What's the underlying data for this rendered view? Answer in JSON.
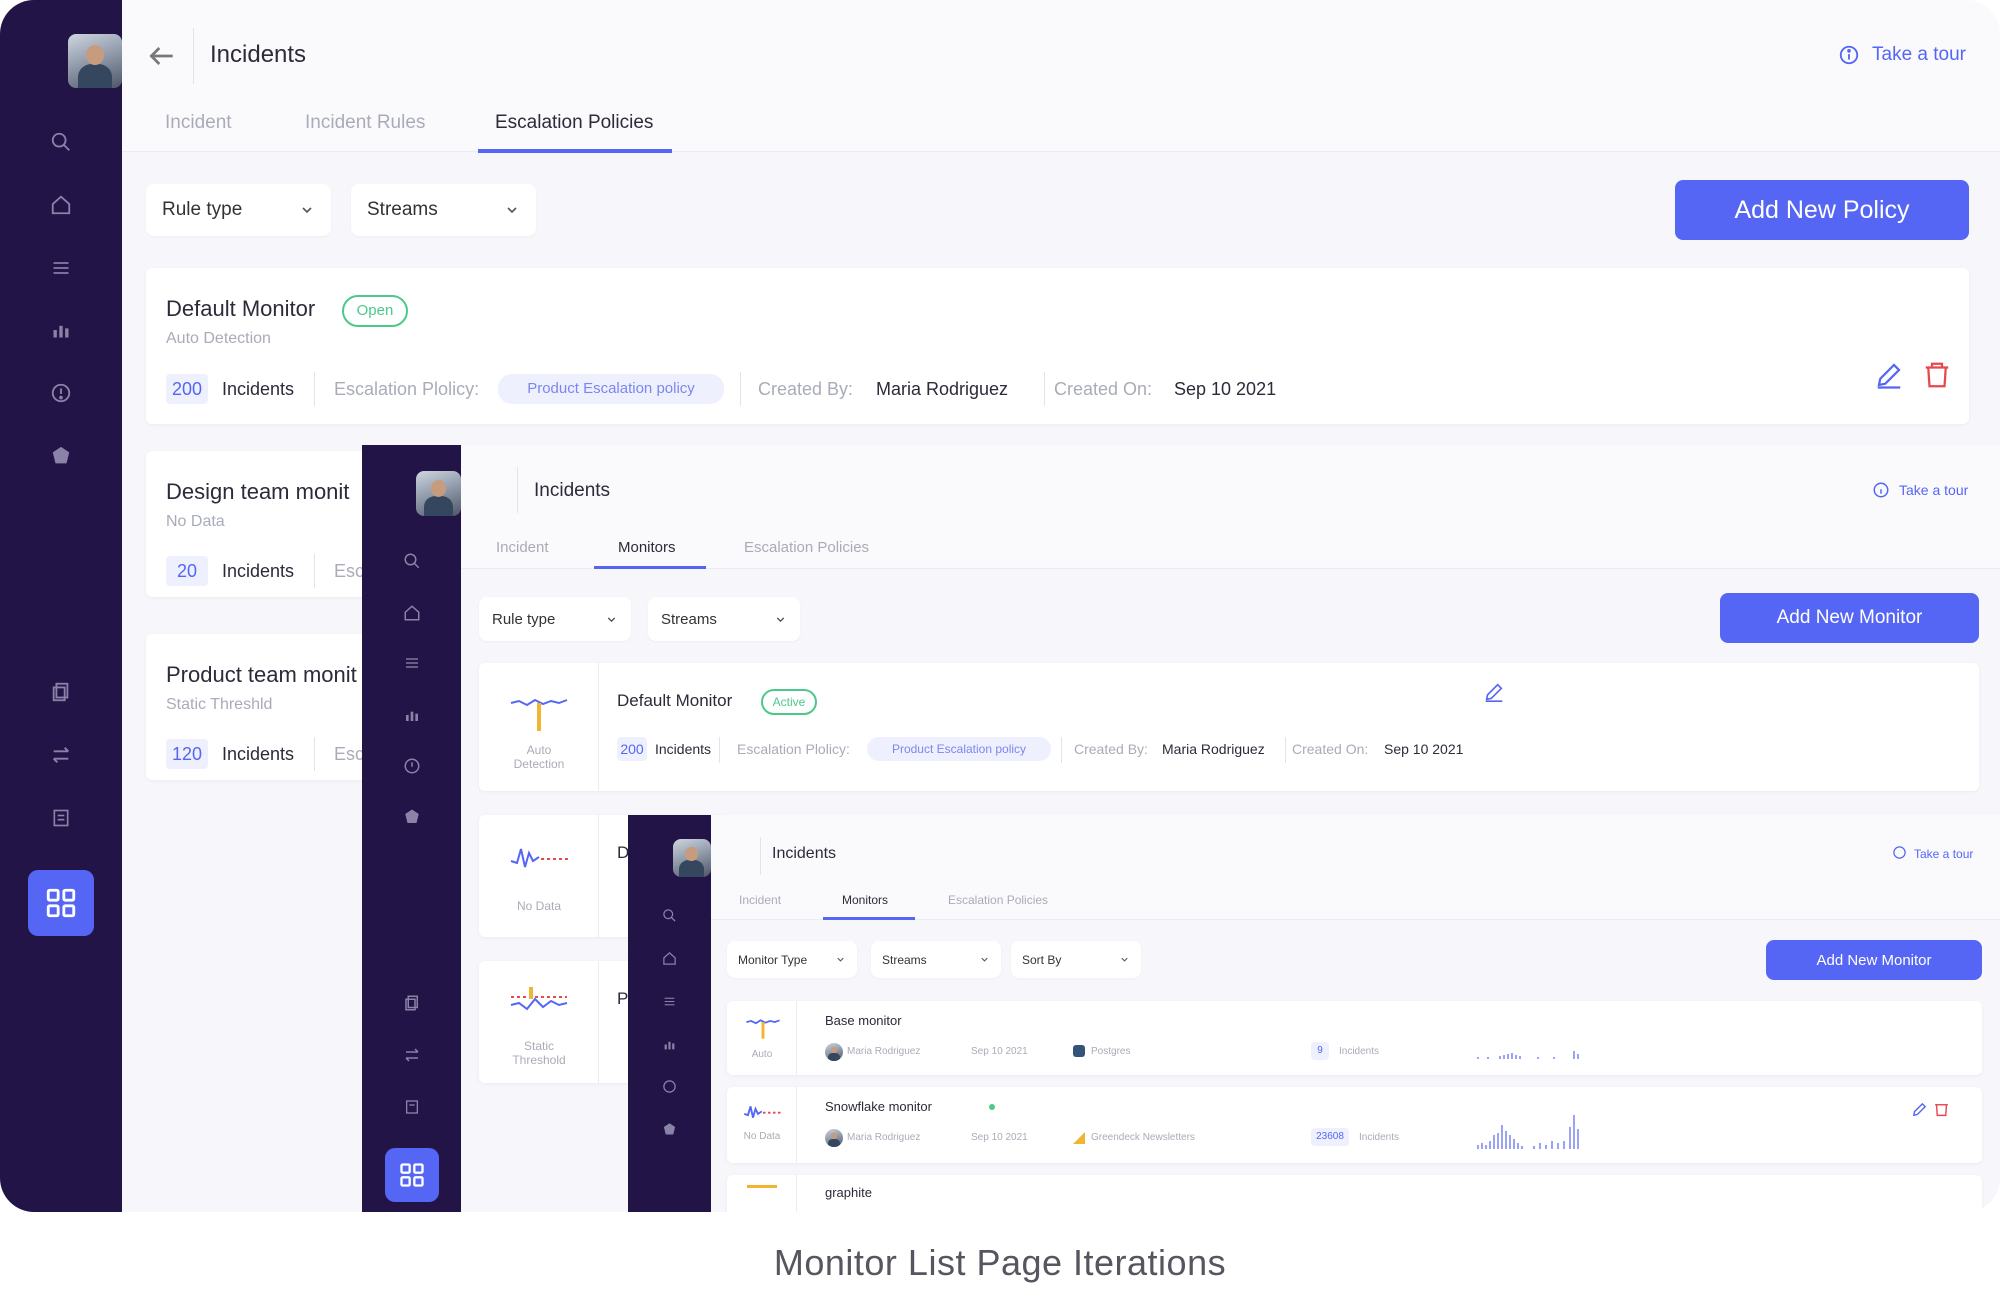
{
  "caption": "Monitor List Page Iterations",
  "v1": {
    "header": {
      "title": "Incidents",
      "tour": "Take a tour"
    },
    "tabs": [
      "Incident",
      "Incident Rules",
      "Escalation Policies"
    ],
    "active_tab": "Escalation Policies",
    "filters": {
      "rule_type": "Rule type",
      "streams": "Streams"
    },
    "add_button": "Add New Policy",
    "cards": [
      {
        "title": "Default Monitor",
        "status": "Open",
        "subtitle": "Auto Detection",
        "count": "200",
        "count_label": "Incidents",
        "esc_label": "Escalation Plolicy:",
        "esc_value": "Product Escalation policy",
        "created_by_label": "Created By:",
        "created_by": "Maria Rodriguez",
        "created_on_label": "Created On:",
        "created_on": "Sep 10 2021"
      },
      {
        "title": "Design team monit",
        "subtitle": "No Data",
        "count": "20",
        "count_label": "Incidents",
        "esc_label": "Esc"
      },
      {
        "title": "Product team monit",
        "subtitle": "Static Threshld",
        "count": "120",
        "count_label": "Incidents",
        "esc_label": "Esc"
      }
    ]
  },
  "v2": {
    "header": {
      "title": "Incidents",
      "tour": "Take a tour"
    },
    "tabs": [
      "Incident",
      "Monitors",
      "Escalation Policies"
    ],
    "active_tab": "Monitors",
    "filters": {
      "rule_type": "Rule type",
      "streams": "Streams"
    },
    "add_button": "Add New Monitor",
    "card": {
      "icon_label_1": "Auto",
      "icon_label_2": "Detection",
      "title": "Default Monitor",
      "status": "Active",
      "count": "200",
      "count_label": "Incidents",
      "esc_label": "Escalation Plolicy:",
      "esc_value": "Product Escalation policy",
      "created_by_label": "Created By:",
      "created_by": "Maria Rodriguez",
      "created_on_label": "Created On:",
      "created_on": "Sep 10 2021"
    },
    "card2_label": "No Data",
    "card2_letter": "D",
    "card3_label_1": "Static",
    "card3_label_2": "Threshold",
    "card3_letter": "P"
  },
  "v3": {
    "header": {
      "title": "Incidents",
      "tour": "Take a tour"
    },
    "tabs": [
      "Incident",
      "Monitors",
      "Escalation Policies"
    ],
    "active_tab": "Monitors",
    "filters": {
      "monitor_type": "Monitor Type",
      "streams": "Streams",
      "sort_by": "Sort By"
    },
    "add_button": "Add New Monitor",
    "rows": [
      {
        "icon_label": "Auto",
        "title": "Base monitor",
        "user": "Maria Rodriguez",
        "date": "Sep 10 2021",
        "source": "Postgres",
        "count": "9",
        "count_label": "Incidents"
      },
      {
        "icon_label": "No Data",
        "title": "Snowflake monitor",
        "user": "Maria Rodriguez",
        "date": "Sep 10 2021",
        "source": "Greendeck Newsletters",
        "count": "23608",
        "count_label": "Incidents"
      },
      {
        "title": "graphite"
      }
    ]
  },
  "colors": {
    "sidebar": "#221446",
    "accent": "#5566f5",
    "success": "#4cc98a",
    "danger": "#e5484d",
    "background": "#f7f7fb"
  }
}
